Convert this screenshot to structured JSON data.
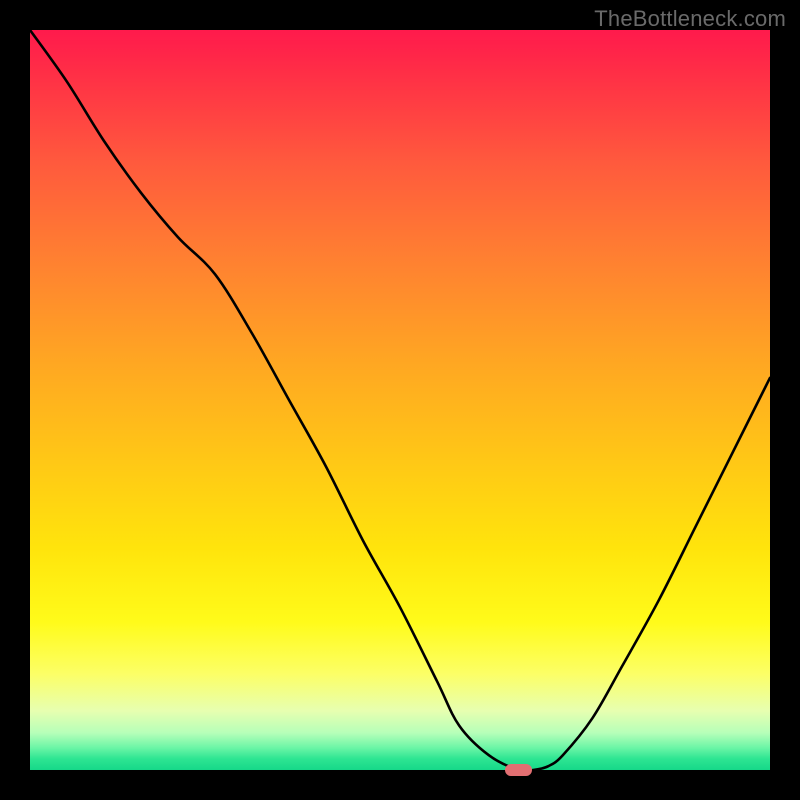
{
  "watermark": "TheBottleneck.com",
  "chart_data": {
    "type": "line",
    "title": "",
    "xlabel": "",
    "ylabel": "",
    "xlim": [
      0,
      100
    ],
    "ylim": [
      0,
      100
    ],
    "series": [
      {
        "name": "curve",
        "x": [
          0,
          5,
          10,
          15,
          20,
          25,
          30,
          35,
          40,
          45,
          50,
          55,
          58,
          62,
          66,
          68,
          70,
          72,
          76,
          80,
          85,
          90,
          95,
          100
        ],
        "y": [
          100,
          93,
          85,
          78,
          72,
          67,
          59,
          50,
          41,
          31,
          22,
          12,
          6,
          2,
          0,
          0,
          0.5,
          2,
          7,
          14,
          23,
          33,
          43,
          53
        ]
      }
    ],
    "marker": {
      "x": 66,
      "y": 0,
      "width_pct": 3.6,
      "height_pct": 1.6
    },
    "gradient_colors": {
      "top": "#ff1a4c",
      "mid_upper": "#ffa722",
      "mid_lower": "#fffb1a",
      "bottom": "#16d889"
    }
  }
}
